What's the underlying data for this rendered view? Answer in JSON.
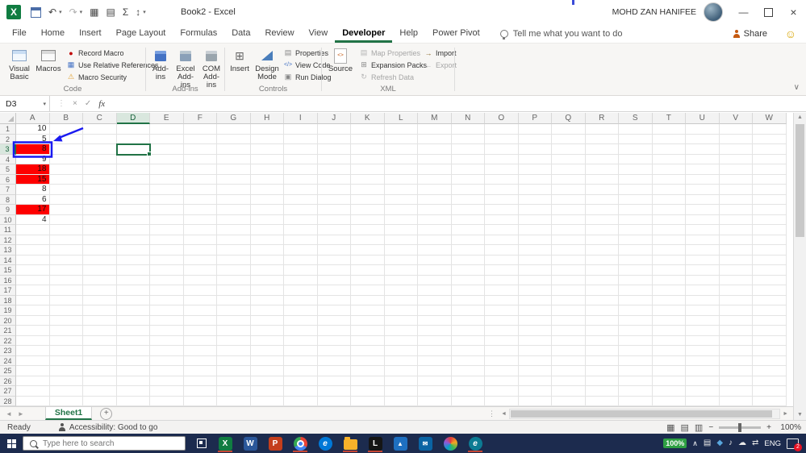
{
  "titlebar": {
    "title": "Book2 - Excel",
    "user_name": "MOHD ZAN HANIFEE",
    "undo": "↶",
    "redo": "↷",
    "dropdown": "▾",
    "minimize": "—",
    "close": "×",
    "qat_icons": [
      {
        "name": "table-icon",
        "glyph": "▦"
      },
      {
        "name": "form-icon",
        "glyph": "▤"
      },
      {
        "name": "autosum-icon",
        "glyph": "Σ"
      },
      {
        "name": "sort-icon",
        "glyph": "↕"
      }
    ]
  },
  "ribbon": {
    "tabs": [
      {
        "label": "File"
      },
      {
        "label": "Home"
      },
      {
        "label": "Insert"
      },
      {
        "label": "Page Layout"
      },
      {
        "label": "Formulas"
      },
      {
        "label": "Data"
      },
      {
        "label": "Review"
      },
      {
        "label": "View"
      },
      {
        "label": "Developer",
        "active": true
      },
      {
        "label": "Help"
      },
      {
        "label": "Power Pivot"
      }
    ],
    "tell_me": "Tell me what you want to do",
    "share_label": "Share",
    "collapse": "∨",
    "code": {
      "label": "Code",
      "visual_basic": "Visual Basic",
      "macros": "Macros",
      "record_macro": "Record Macro",
      "use_relative_references": "Use Relative References",
      "macro_security": "Macro Security"
    },
    "addins": {
      "label": "Add-ins",
      "addins": "Add-ins",
      "excel_addins": "Excel Add-ins",
      "com_addins": "COM Add-ins"
    },
    "controls": {
      "label": "Controls",
      "insert": "Insert",
      "design_mode": "Design Mode",
      "properties": "Properties",
      "view_code": "View Code",
      "run_dialog": "Run Dialog"
    },
    "xml": {
      "label": "XML",
      "source": "Source",
      "map_properties": "Map Properties",
      "expansion_packs": "Expansion Packs",
      "refresh_data": "Refresh Data",
      "import": "Import",
      "export": "Export"
    }
  },
  "glyphs": {
    "record_macro": "●",
    "relative_refs": "▦",
    "macro_security": "⚠",
    "insert_tool": "⊞",
    "properties": "▤",
    "view_code": "</>",
    "run_dialog": "▣",
    "map_properties": "▤",
    "expansion_packs": "⊞",
    "refresh_data": "↻",
    "import": "→",
    "export": "←"
  },
  "formula_bar": {
    "name_box": "D3",
    "dots": "⋮",
    "cancel": "×",
    "enter": "✓",
    "fx": "fx",
    "dropdown": "▾",
    "value": ""
  },
  "grid": {
    "columns": [
      "A",
      "B",
      "C",
      "D",
      "E",
      "F",
      "G",
      "H",
      "I",
      "J",
      "K",
      "L",
      "M",
      "N",
      "O",
      "P",
      "Q",
      "R",
      "S",
      "T",
      "U",
      "V",
      "W"
    ],
    "row_count": 28,
    "col_a_values": {
      "1": 10,
      "2": 5,
      "3": 8,
      "4": 9,
      "5": 18,
      "6": 15,
      "7": 8,
      "8": 6,
      "9": 17,
      "10": 4
    },
    "red_rows": [
      3,
      5,
      6,
      9
    ],
    "selected_cell": "D3",
    "selected_col": "D",
    "selected_row": 3,
    "vscroll_up": "▲",
    "vscroll_down": "▼"
  },
  "sheet_bar": {
    "nav_left": "◄",
    "nav_right": "►",
    "tab": "Sheet1",
    "add": "+",
    "dots": "⋮",
    "hscroll_left": "◄",
    "hscroll_right": "►"
  },
  "status_bar": {
    "mode": "Ready",
    "accessibility": "Accessibility: Good to go",
    "views": [
      {
        "name": "normal-view-icon",
        "glyph": "▦"
      },
      {
        "name": "page-layout-view-icon",
        "glyph": "▤"
      },
      {
        "name": "page-break-view-icon",
        "glyph": "▥"
      }
    ],
    "zoom_minus": "−",
    "zoom_plus": "+",
    "zoom_level": "100%"
  },
  "taskbar": {
    "search_placeholder": "Type here to search",
    "battery": "100%",
    "chevron": "∧",
    "language": "ENG",
    "notification_count": "2",
    "apps": [
      {
        "name": "excel-app-icon",
        "style": "square",
        "color": "#107c41",
        "letter": "X",
        "running": true
      },
      {
        "name": "word-app-icon",
        "style": "square",
        "color": "#2b579a",
        "letter": "W",
        "running": false
      },
      {
        "name": "powerpoint-app-icon",
        "style": "square",
        "color": "#c43e1c",
        "letter": "P",
        "running": false
      },
      {
        "name": "chrome-app-icon",
        "style": "chrome",
        "letter": "",
        "running": true
      },
      {
        "name": "edge-app-icon",
        "style": "circle",
        "color": "#0078d7",
        "letter": "e",
        "running": false
      },
      {
        "name": "file-explorer-app-icon",
        "style": "folder",
        "letter": "",
        "running": true
      },
      {
        "name": "l-app-icon",
        "style": "square",
        "color": "#151515",
        "letter": "L",
        "running": true
      },
      {
        "name": "photos-app-icon",
        "style": "square",
        "color": "#1e6fc0",
        "letter": "▲",
        "running": false
      },
      {
        "name": "outlook-app-icon",
        "style": "square",
        "color": "#0a64a4",
        "letter": "✉",
        "running": false
      },
      {
        "name": "pinwheel-app-icon",
        "style": "pinwheel",
        "letter": "",
        "running": false
      },
      {
        "name": "edge-beta-app-icon",
        "style": "circle",
        "color": "#0c7b93",
        "letter": "e",
        "running": true
      }
    ],
    "tray_icons": [
      {
        "name": "display-icon",
        "glyph": "▤",
        "color": "#e8e8e8"
      },
      {
        "name": "shield-icon",
        "glyph": "◆",
        "color": "#58a6dd"
      },
      {
        "name": "speaker-icon",
        "glyph": "♪",
        "color": "#e8e8e8"
      },
      {
        "name": "cloud-icon",
        "glyph": "☁",
        "color": "#e8e8e8"
      },
      {
        "name": "network-icon",
        "glyph": "⇄",
        "color": "#e8e8e8"
      }
    ]
  },
  "annotation": {
    "target": "A3",
    "color": "#1a1af0"
  }
}
